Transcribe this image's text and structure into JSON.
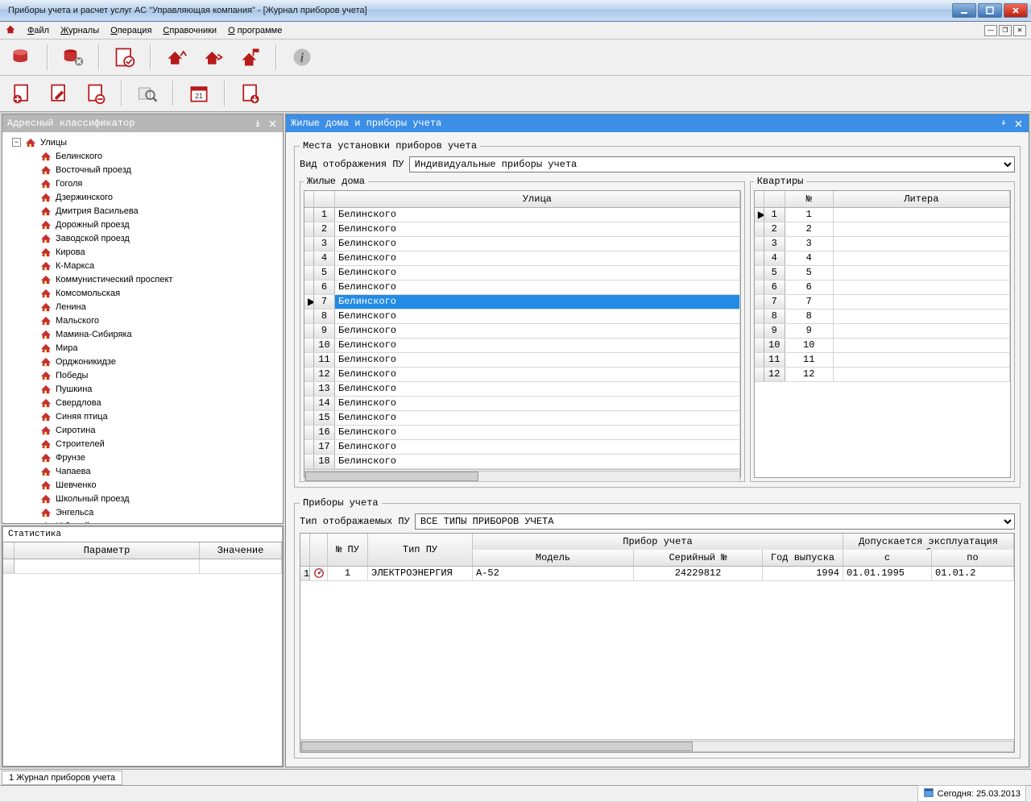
{
  "window": {
    "title": "Приборы учета и расчет услуг АС \"Управляющая компания\" - [Журнал приборов учета]"
  },
  "menu": {
    "items": [
      "Файл",
      "Журналы",
      "Операция",
      "Справочники",
      "О программе"
    ]
  },
  "panels": {
    "classifier_title": "Адресный классификатор",
    "houses_title": "Жилые дома и приборы учета",
    "install_group": "Места установки приборов учета",
    "view_label": "Вид отображения ПУ",
    "view_value": "Индивидуальные приборы учета",
    "houses_group": "Жилые дома",
    "apartments_group": "Квартиры",
    "devices_group": "Приборы учета",
    "device_type_label": "Тип отображаемых ПУ",
    "device_type_value": "ВСЕ ТИПЫ ПРИБОРОВ УЧЕТА",
    "stats_title": "Статистика"
  },
  "tree": {
    "root": "Улицы",
    "items": [
      "Белинского",
      "Восточный проезд",
      "Гоголя",
      "Дзержинского",
      "Дмитрия Васильева",
      "Дорожный проезд",
      "Заводской проезд",
      "Кирова",
      "К-Маркса",
      "Коммунистический проспект",
      "Комсомольская",
      "Ленина",
      "Мальского",
      "Мамина-Сибиряка",
      "Мира",
      "Орджоникидзе",
      "Победы",
      "Пушкина",
      "Свердлова",
      "Синяя птица",
      "Сиротина",
      "Строителей",
      "Фрунзе",
      "Чапаева",
      "Шевченко",
      "Школьный проезд",
      "Энгельса",
      "Юбилейная"
    ]
  },
  "houses": {
    "header_street": "Улица",
    "rows": [
      "Белинского",
      "Белинского",
      "Белинского",
      "Белинского",
      "Белинского",
      "Белинского",
      "Белинского",
      "Белинского",
      "Белинского",
      "Белинского",
      "Белинского",
      "Белинского",
      "Белинского",
      "Белинского",
      "Белинского",
      "Белинского",
      "Белинского",
      "Белинского"
    ],
    "selected_index": 6
  },
  "apartments": {
    "header_no": "№",
    "header_lit": "Литера",
    "rows": [
      1,
      2,
      3,
      4,
      5,
      6,
      7,
      8,
      9,
      10,
      11,
      12
    ],
    "selected_index": 0
  },
  "stats": {
    "col_param": "Параметр",
    "col_value": "Значение"
  },
  "devices": {
    "h_no": "№ ПУ",
    "h_type": "Тип ПУ",
    "h_device": "Прибор учета",
    "h_model": "Модель",
    "h_serial": "Серийный №",
    "h_year": "Год выпуска",
    "h_allowed": "Допускается эксплуатация прибора",
    "h_from": "с",
    "h_to": "по",
    "row": {
      "no": "1",
      "type": "ЭЛЕКТРОЭНЕРГИЯ",
      "model": "А-52",
      "serial": "24229812",
      "year": "1994",
      "from": "01.01.1995",
      "to": "01.01.2"
    }
  },
  "tabbar": {
    "tab1": "1 Журнал приборов учета"
  },
  "statusbar": {
    "date_label": "Сегодня: 25.03.2013"
  }
}
